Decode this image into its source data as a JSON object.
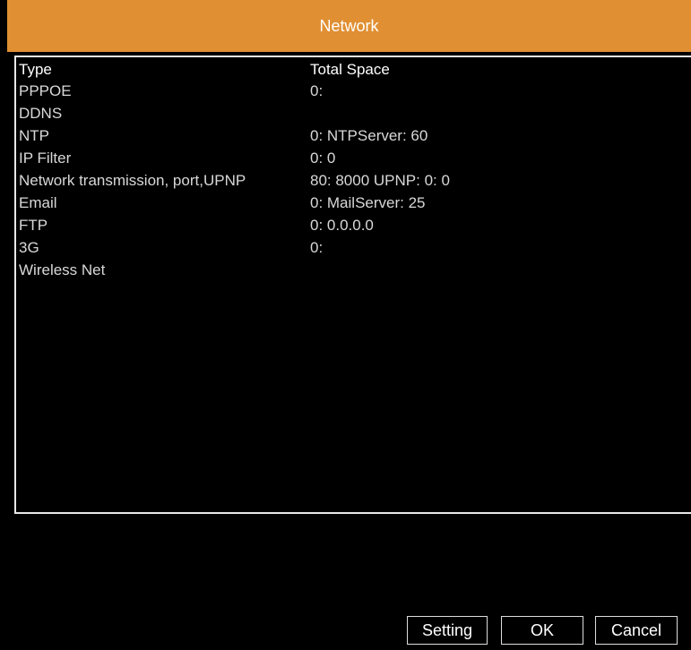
{
  "window": {
    "title": "Network"
  },
  "table": {
    "headers": {
      "type": "Type",
      "space": "Total Space"
    },
    "rows": [
      {
        "type": "PPPOE",
        "space": "0:"
      },
      {
        "type": "DDNS",
        "space": ""
      },
      {
        "type": "NTP",
        "space": "0: NTPServer: 60"
      },
      {
        "type": "IP Filter",
        "space": "0: 0"
      },
      {
        "type": "Network transmission, port,UPNP",
        "space": "80: 8000 UPNP: 0: 0"
      },
      {
        "type": "Email",
        "space": "0: MailServer: 25"
      },
      {
        "type": "FTP",
        "space": "0: 0.0.0.0"
      },
      {
        "type": "3G",
        "space": "0:"
      },
      {
        "type": "Wireless Net",
        "space": ""
      }
    ]
  },
  "buttons": {
    "setting": "Setting",
    "ok": "OK",
    "cancel": "Cancel"
  },
  "colors": {
    "titlebar": "#E08F32",
    "background": "#000000",
    "text": "#FFFFFF"
  }
}
